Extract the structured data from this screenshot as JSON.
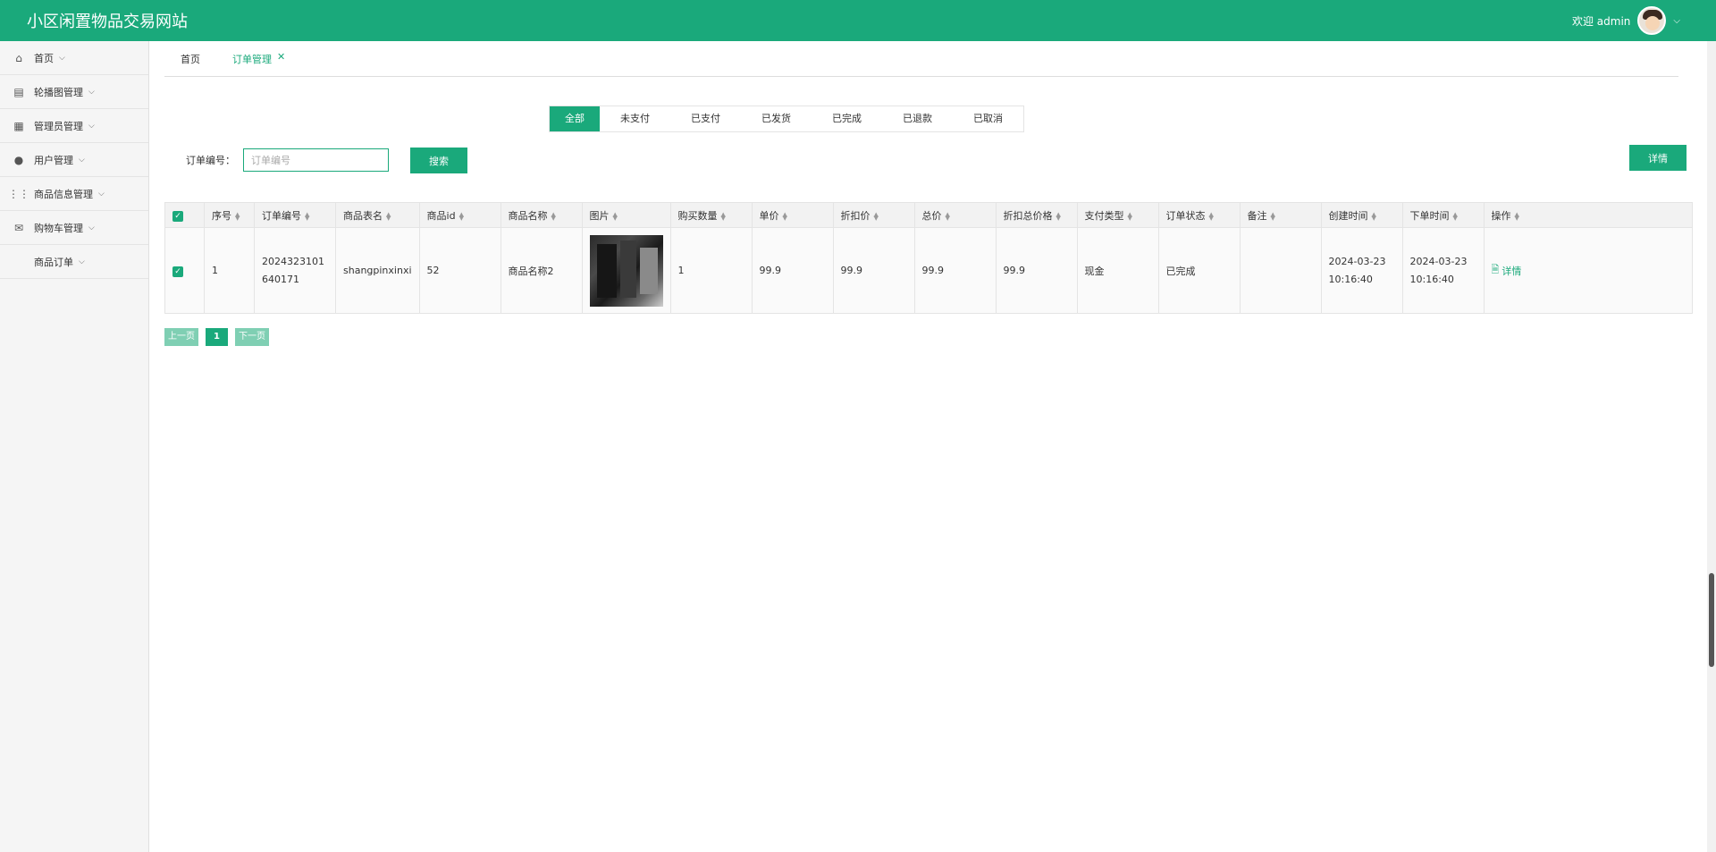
{
  "app": {
    "title": "小区闲置物品交易网站"
  },
  "header": {
    "welcome": "欢迎 admin",
    "chevron": "chevron-down-icon"
  },
  "sidebar": {
    "items": [
      {
        "label": "首页",
        "icon": "home-icon"
      },
      {
        "label": "轮播图管理",
        "icon": "carousel-icon"
      },
      {
        "label": "管理员管理",
        "icon": "admin-icon"
      },
      {
        "label": "用户管理",
        "icon": "user-icon"
      },
      {
        "label": "商品信息管理",
        "icon": "grid-icon"
      },
      {
        "label": "购物车管理",
        "icon": "mail-icon"
      },
      {
        "label": "商品订单",
        "icon": ""
      }
    ]
  },
  "tabs": [
    {
      "label": "首页"
    },
    {
      "label": "订单管理",
      "active": true
    }
  ],
  "status_tabs": [
    "全部",
    "未支付",
    "已支付",
    "已发货",
    "已完成",
    "已退款",
    "已取消"
  ],
  "search": {
    "label": "订单编号：",
    "placeholder": "订单编号",
    "button": "搜索",
    "detail_button": "详情"
  },
  "table": {
    "headers": [
      "序号",
      "订单编号",
      "商品表名",
      "商品id",
      "商品名称",
      "图片",
      "购买数量",
      "单价",
      "折扣价",
      "总价",
      "折扣总价格",
      "支付类型",
      "订单状态",
      "备注",
      "创建时间",
      "下单时间",
      "操作"
    ],
    "rows": [
      {
        "index": "1",
        "order_no": "2024323101640171",
        "table_name": "shangpinxinxi",
        "product_id": "52",
        "product_name": "商品名称2",
        "quantity": "1",
        "unit_price": "99.9",
        "discount_price": "99.9",
        "total": "99.9",
        "discount_total": "99.9",
        "pay_type": "现金",
        "status": "已完成",
        "remark": "",
        "created": "2024-03-23 10:16:40",
        "ordered": "2024-03-23 10:16:40",
        "action": "详情"
      }
    ]
  },
  "pager": {
    "prev": "上一页",
    "current": "1",
    "next": "下一页"
  },
  "colors": {
    "primary": "#1aa97b",
    "light": "#7fcfb3"
  }
}
